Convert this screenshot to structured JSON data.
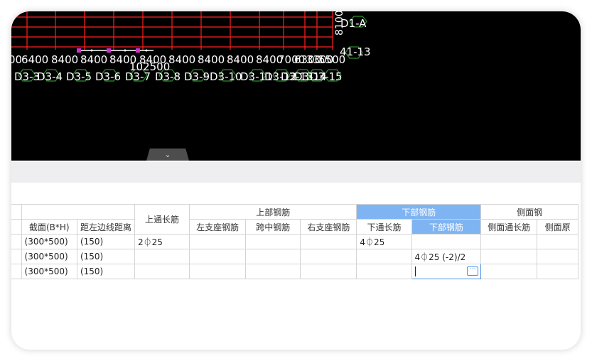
{
  "canvas": {
    "top_labels": [
      "D1-A",
      "41-13"
    ],
    "vertical_label": "8100",
    "dim_labels": [
      "00",
      "6400",
      "8400",
      "8400",
      "8400",
      "8400",
      "8400",
      "8400",
      "8400",
      "8400",
      "7000",
      "6300",
      "3300",
      "5500"
    ],
    "total_label": "102500",
    "beam_labels": [
      "D3-3",
      "D3-4",
      "D3-5",
      "D3-6",
      "D3-7",
      "D3-8",
      "D3-9",
      "D3-10",
      "D3-11",
      "D3-12",
      "D3-13",
      "D3-14",
      "D3-15"
    ],
    "collapse_icon": "chevron-down-icon"
  },
  "table": {
    "headers_group": {
      "top_rebar": "上部钢筋",
      "bottom_rebar": "下部钢筋",
      "side_rebar": "侧面钢"
    },
    "headers": {
      "section": "截面(B*H)",
      "left_dist": "距左边线距离",
      "top_through": "上通长筋",
      "left_support": "左支座钢筋",
      "mid_span": "跨中钢筋",
      "right_support": "右支座钢筋",
      "bottom_through": "下通长筋",
      "bottom_rebar": "下部钢筋",
      "side_through": "侧面通长筋",
      "side_extra": "侧面原"
    },
    "rows": [
      {
        "section": "(300*500)",
        "left_dist": "(150)",
        "top_through": "2⏀25",
        "bottom_through": "4⏀25",
        "bottom_rebar": ""
      },
      {
        "section": "(300*500)",
        "left_dist": "(150)",
        "top_through": "",
        "bottom_through": "",
        "bottom_rebar": "4⏀25 (-2)/2"
      },
      {
        "section": "(300*500)",
        "left_dist": "(150)",
        "top_through": "",
        "bottom_through": "",
        "bottom_rebar": ""
      }
    ],
    "edit_button": "···"
  },
  "colors": {
    "grid_red": "#ff2020",
    "hex_green": "#2e8b2e",
    "selected_header": "#7fb4f2"
  }
}
